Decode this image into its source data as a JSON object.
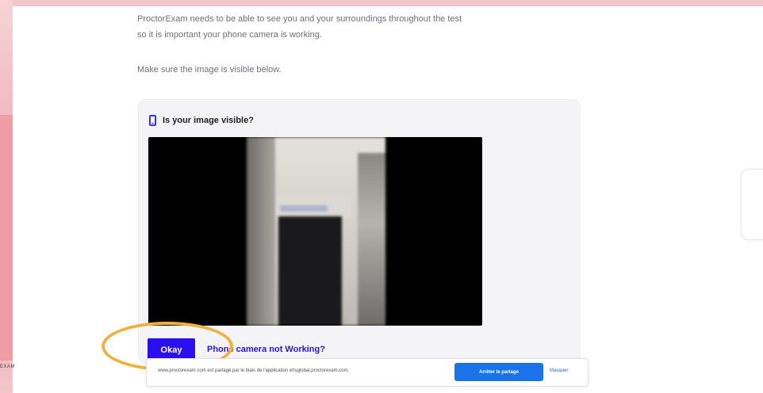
{
  "intro": {
    "line1": "ProctorExam needs to be able to see you and your surroundings throughout the test",
    "line2": "so it is important your phone camera is working.",
    "instruction": "Make sure the image is visible below."
  },
  "card": {
    "title": "Is your image visible?",
    "icon": "phone-icon"
  },
  "actions": {
    "okay_label": "Okay",
    "camera_link": "Phone camera not Working?"
  },
  "logo": {
    "text": "EXAM"
  },
  "share_bar": {
    "message": "www.proctorexam.com est partagé par le biais de l'application ehsglobal.proctorexam.com.",
    "share_button": "Arrêter le partage",
    "hide_link": "Masquer"
  },
  "colors": {
    "accent": "#2b0ff0",
    "highlight": "#f1b03c",
    "share_blue": "#1a73e8",
    "pink": "#ef9ca4"
  }
}
